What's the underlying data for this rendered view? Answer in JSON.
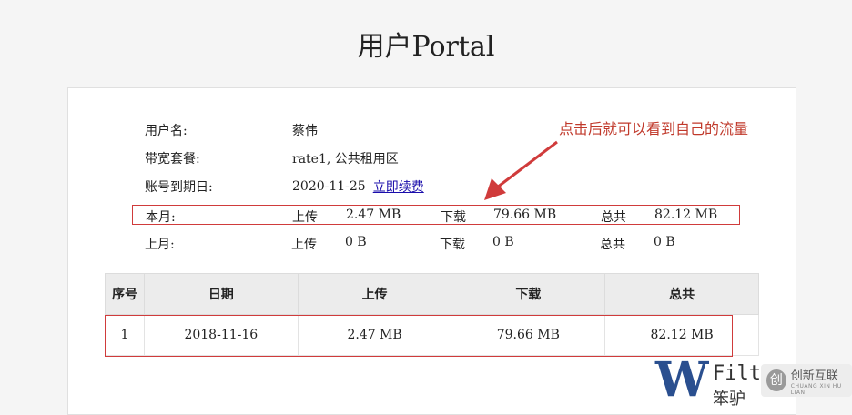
{
  "page": {
    "title": "用户Portal"
  },
  "account": {
    "username_label": "用户名:",
    "username": "蔡伟",
    "plan_label": "带宽套餐:",
    "plan": "rate1, 公共租用区",
    "expiry_label": "账号到期日:",
    "expiry": "2020-11-25",
    "renew_link": "立即续费"
  },
  "traffic": {
    "upload_label": "上传",
    "download_label": "下载",
    "total_label": "总共",
    "this_month": {
      "label": "本月:",
      "upload": "2.47 MB",
      "download": "79.66 MB",
      "total": "82.12 MB"
    },
    "last_month": {
      "label": "上月:",
      "upload": "0 B",
      "download": "0 B",
      "total": "0 B"
    }
  },
  "annotation": {
    "text": "点击后就可以看到自己的流量",
    "color": "#c0392b"
  },
  "table": {
    "headers": [
      "序号",
      "日期",
      "上传",
      "下载",
      "总共"
    ],
    "rows": [
      [
        "1",
        "2018-11-16",
        "2.47 MB",
        "79.66 MB",
        "82.12 MB"
      ]
    ]
  },
  "watermark": {
    "logo_letter": "W",
    "line1": "Filt",
    "line2": "笨驴"
  },
  "brand_badge": {
    "icon": "创",
    "name": "创新互联",
    "sub": "CHUANG XIN HU LIAN"
  },
  "colors": {
    "accent_red": "#d03b3b",
    "link": "#1a0dab",
    "logo_blue": "#2a4f8f"
  }
}
